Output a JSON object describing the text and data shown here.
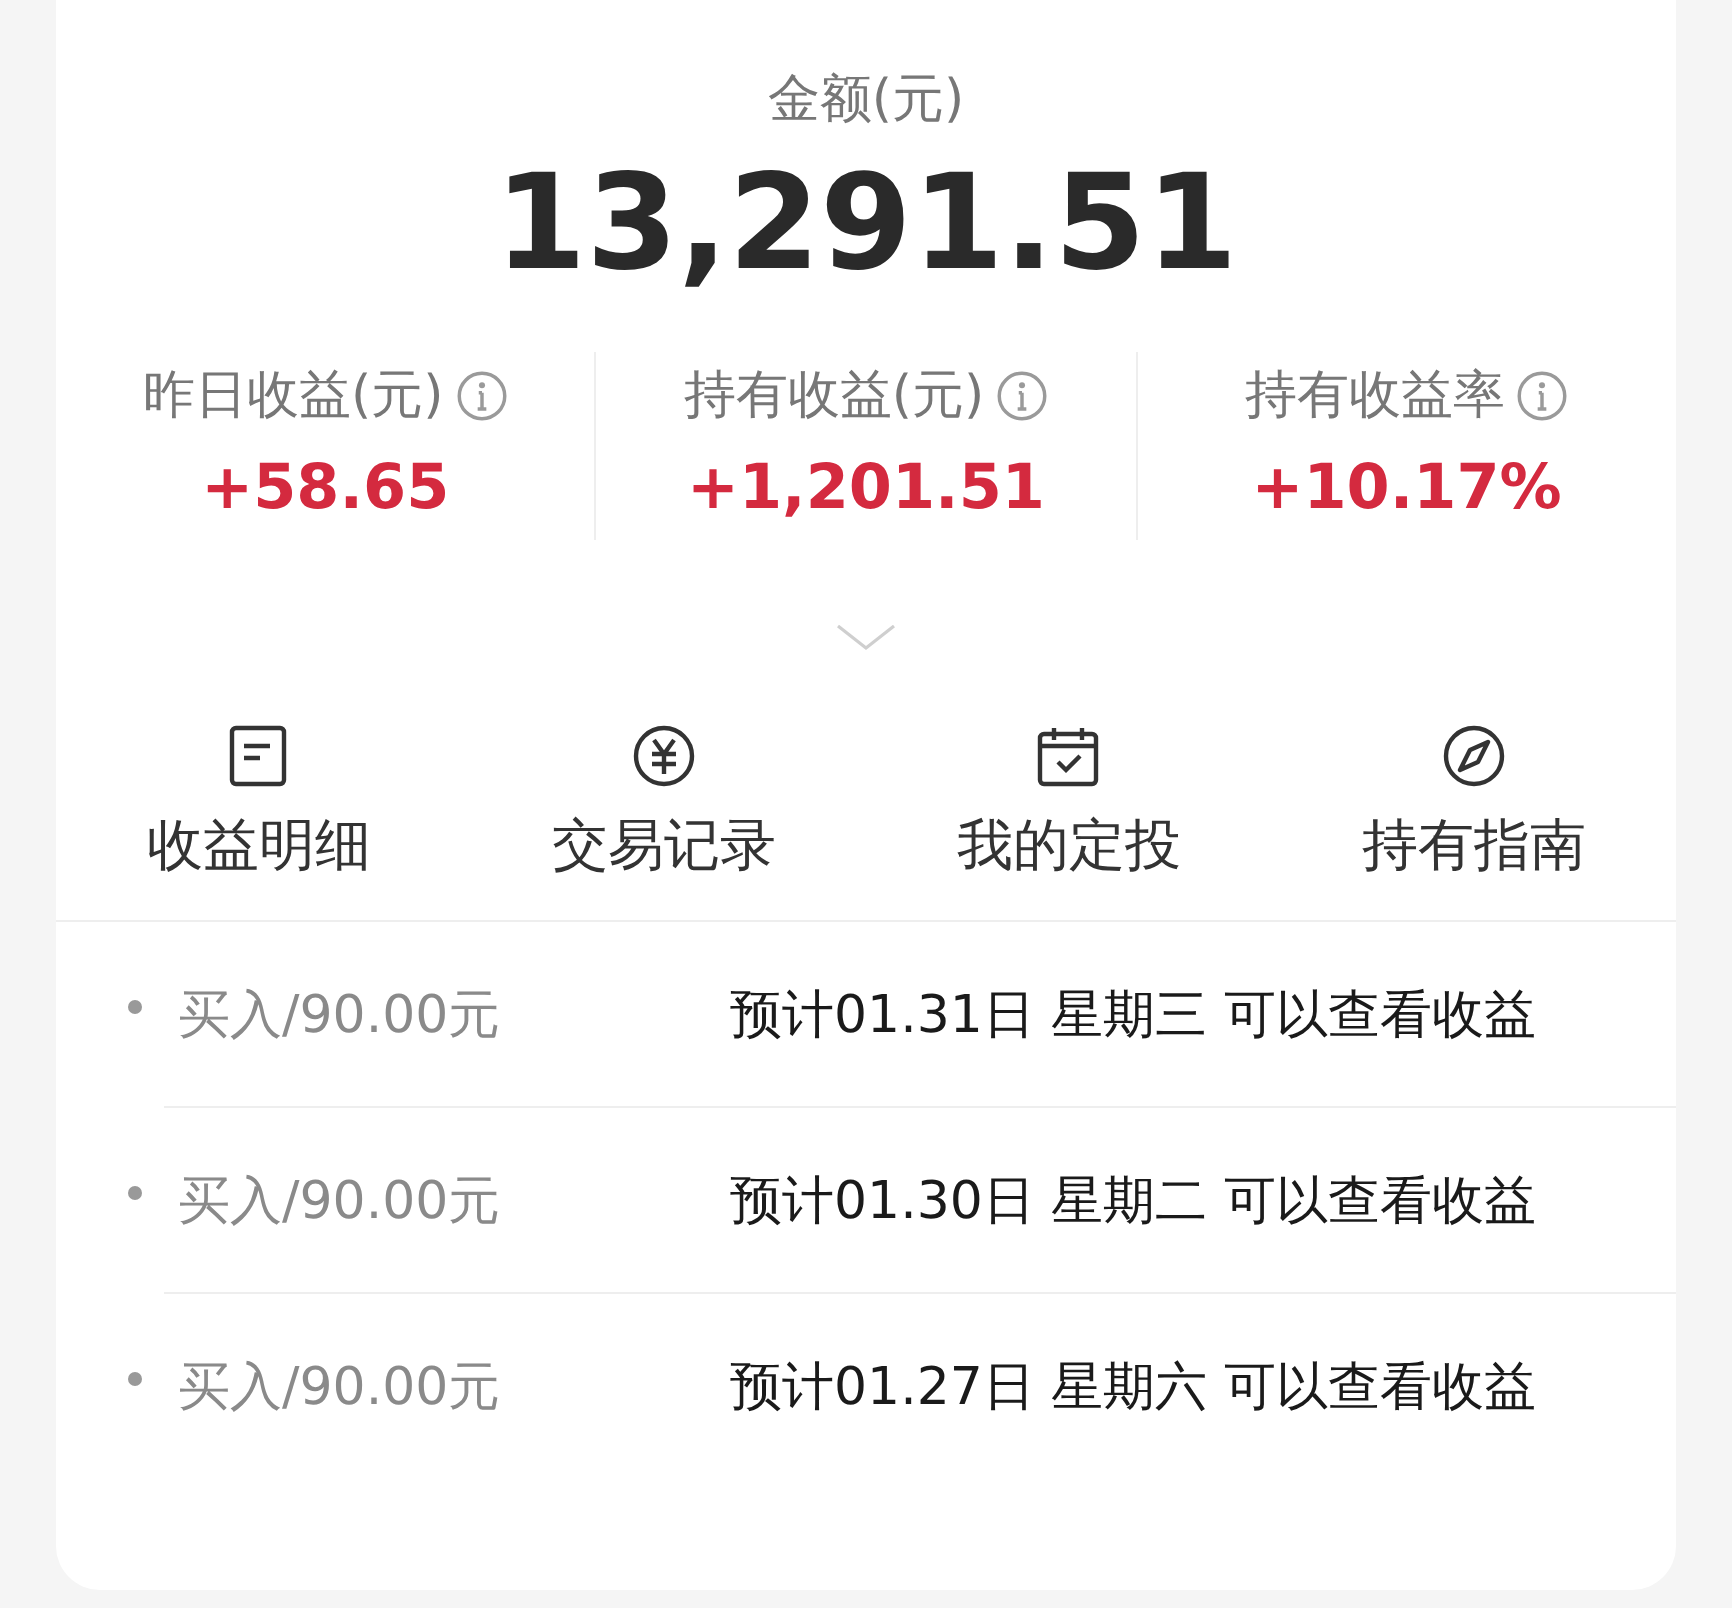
{
  "total": {
    "label": "金额(元)",
    "value": "13,291.51"
  },
  "stats": [
    {
      "label": "昨日收益(元)",
      "value": "+58.65"
    },
    {
      "label": "持有收益(元)",
      "value": "+1,201.51"
    },
    {
      "label": "持有收益率",
      "value": "+10.17%"
    }
  ],
  "shortcuts": [
    {
      "label": "收益明细"
    },
    {
      "label": "交易记录"
    },
    {
      "label": "我的定投"
    },
    {
      "label": "持有指南"
    }
  ],
  "records": [
    {
      "amount": "买入/90.00元",
      "note": "预计01.31日 星期三 可以查看收益"
    },
    {
      "amount": "买入/90.00元",
      "note": "预计01.30日 星期二 可以查看收益"
    },
    {
      "amount": "买入/90.00元",
      "note": "预计01.27日 星期六 可以查看收益"
    }
  ]
}
